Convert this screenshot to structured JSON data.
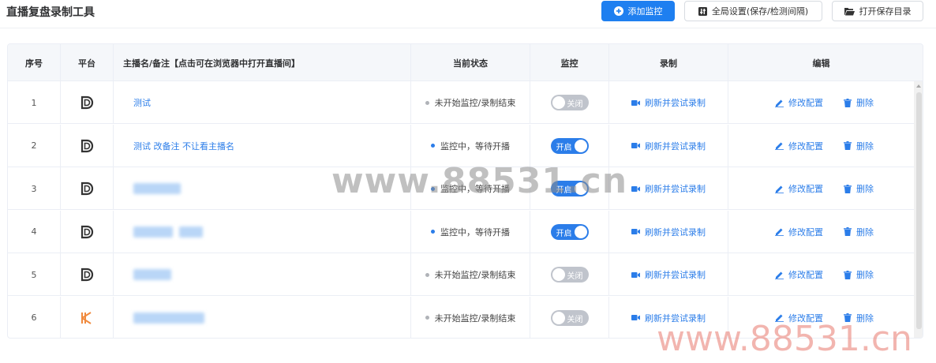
{
  "app": {
    "title": "直播复盘录制工具"
  },
  "toolbar": {
    "add_label": "添加监控",
    "settings_label": "全局设置(保存/检测间隔)",
    "open_dir_label": "打开保存目录"
  },
  "columns": {
    "index": "序号",
    "platform": "平台",
    "name": "主播名/备注【点击可在浏览器中打开直播间】",
    "status": "当前状态",
    "monitor": "监控",
    "record": "录制",
    "edit": "编辑"
  },
  "rows": [
    {
      "index": "1",
      "platform_icon": "douyin-d-icon",
      "name": "测试",
      "status": "未开始监控/录制结束",
      "monitor": "关闭",
      "record": "刷新并尝试录制",
      "edit": "修改配置",
      "delete": "删除"
    },
    {
      "index": "2",
      "platform_icon": "douyin-d-icon",
      "name": "测试 改备注 不让看主播名",
      "status": "监控中，等待开播",
      "monitor": "开启",
      "record": "刷新并尝试录制",
      "edit": "修改配置",
      "delete": "删除"
    },
    {
      "index": "3",
      "platform_icon": "douyin-d-icon",
      "name": "",
      "status": "监控中，等待开播",
      "monitor": "开启",
      "record": "刷新并尝试录制",
      "edit": "修改配置",
      "delete": "删除"
    },
    {
      "index": "4",
      "platform_icon": "douyin-d-icon",
      "name": "",
      "status": "监控中，等待开播",
      "monitor": "开启",
      "record": "刷新并尝试录制",
      "edit": "修改配置",
      "delete": "删除"
    },
    {
      "index": "5",
      "platform_icon": "douyin-d-icon",
      "name": "",
      "status": "未开始监控/录制结束",
      "monitor": "关闭",
      "record": "刷新并尝试录制",
      "edit": "修改配置",
      "delete": "删除"
    },
    {
      "index": "6",
      "platform_icon": "kuaishou-k-icon",
      "name": "吉",
      "status": "未开始监控/录制结束",
      "monitor": "关闭",
      "record": "刷新并尝试录制",
      "edit": "修改配置",
      "delete": "删除"
    }
  ],
  "watermarks": [
    "www.88531.cn",
    "www.88531.cn"
  ],
  "colors": {
    "primary": "#1e7ff0",
    "link": "#2b7de9",
    "switch_off": "#c0c4cc",
    "dot_idle": "#b0b3b8",
    "kuaishou": "#f08a3e"
  }
}
